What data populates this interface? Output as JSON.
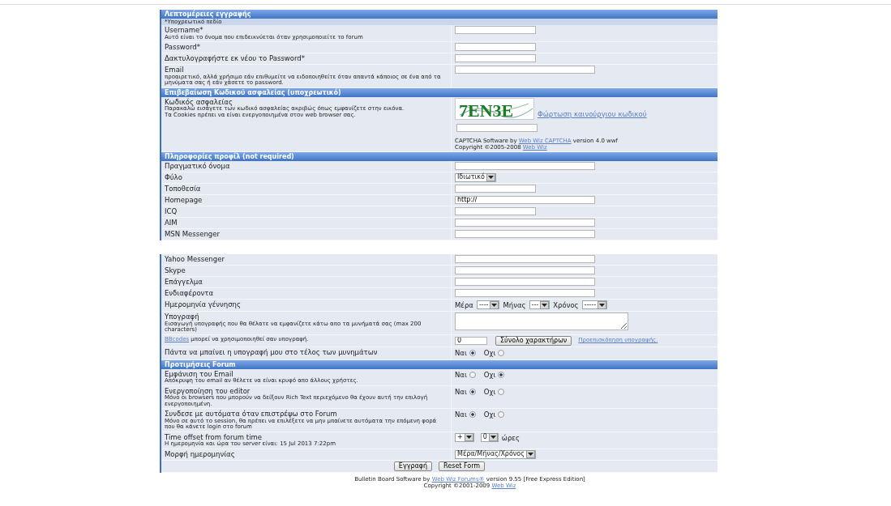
{
  "panels": [
    {
      "rows": [
        {
          "kind": "header",
          "text": "Λεπτομέρειες εγγραφής"
        },
        {
          "kind": "note",
          "text": "*Υποχρεωτικό πεδίο"
        },
        {
          "kind": "short_input",
          "label": "Username*",
          "hint": "Αυτό είναι το όνομα που επιδεικνύεται όταν χρησιμοποιείτε το forum"
        },
        {
          "kind": "short_input",
          "label": "Password*"
        },
        {
          "kind": "short_input",
          "label": "Δακτυλογραφήστε εκ νέου το Password*"
        },
        {
          "kind": "long_input",
          "label": "Email",
          "hint": "προαιρετικό, αλλά χρήσιμο εάν επιθυμείτε να ειδοποιηθείτε όταν απαντά κάποιος σε ένα από τα μηνύματα σας ή εάν χάσετε το password."
        },
        {
          "kind": "header",
          "text": "Επιβεβαίωση Κωδικού ασφαλείας (υποχρεωτικό)"
        },
        {
          "kind": "captcha",
          "label": "Κωδικός ασφαλείας",
          "hint": "Παρακαλώ εισάγετε των κωδικό ασφαλείας ακριβώς όπως εμφανίζετε στην εικόνα.",
          "hint2": "Τα Cookies πρέπει να είναι ενεργοποιημένα στον web browser σας.",
          "image_text": "7EN3E",
          "reload": "Φώρτωση καινούργιου κωδικού",
          "credits": [
            {
              "before": "CAPTCHA Software by ",
              "link": "Web Wiz CAPTCHA",
              "after": " version 4.0 wwf"
            },
            {
              "before": "Copyright ©2005-2008 ",
              "link": "Web Wiz"
            }
          ]
        },
        {
          "kind": "header",
          "text": "Πληροφορίες προφίλ (not required)"
        },
        {
          "kind": "long_input",
          "label": "Πραγματικό όνομα"
        },
        {
          "kind": "select",
          "label": "Φύλο",
          "value": "Ιδιωτικό"
        },
        {
          "kind": "short_input",
          "label": "Τοποθεσία"
        },
        {
          "kind": "long_input",
          "label": "Homepage",
          "value": "http://"
        },
        {
          "kind": "short_input",
          "label": "ICQ"
        },
        {
          "kind": "long_input",
          "label": "AIM"
        },
        {
          "kind": "long_input",
          "label": "MSN Messenger"
        }
      ]
    },
    {
      "rows": [
        {
          "kind": "long_input",
          "label": "Yahoo Messenger"
        },
        {
          "kind": "long_input",
          "label": "Skype"
        },
        {
          "kind": "long_input",
          "label": "Επάγγελμα"
        },
        {
          "kind": "long_input",
          "label": "Ενδιαφέροντα"
        },
        {
          "kind": "date",
          "label": "Ημερομηνία γέννησης",
          "parts": [
            {
              "label": "Μέρα",
              "value": "----"
            },
            {
              "label": "Μήνας",
              "value": "---"
            },
            {
              "label": "Χρόνος",
              "value": "-----"
            }
          ]
        },
        {
          "kind": "textarea",
          "label": "Υπογραφή",
          "hint": "Εισαγωγή υπογραφής που θα θέλατε να εμφανίζετε κάτω απο τα μυνήματά σας (max 200 characters)"
        },
        {
          "kind": "counter",
          "text": {
            "link": "BBcodes",
            "after": " μπορεί να χρησιμοποιηθεί σαν υπογραφή."
          },
          "value": "0",
          "button": "Σύνολο χαρακτήρων",
          "link": "Προεπισκόπηση υπογραφής."
        },
        {
          "kind": "radio",
          "label": "Πάντα να μπαίνει η υπογραφή μου στο τέλος των μυνημάτων",
          "options": [
            {
              "label": "Ναι",
              "selected": true
            },
            {
              "label": "Οχι",
              "selected": false
            }
          ]
        },
        {
          "kind": "header",
          "text": "Προτιμήσεις Forum"
        },
        {
          "kind": "radio",
          "label": "Εμφάνιση του Email",
          "hint": "Απόκρυψη του email αν θέλετε να είναι κρυφό απο άλλους χρήστες.",
          "options": [
            {
              "label": "Ναι",
              "selected": false
            },
            {
              "label": "Οχι",
              "selected": true
            }
          ]
        },
        {
          "kind": "radio",
          "label": "Ενεργοποίηση του editor",
          "hint": "Μόνο οι browsers που μπορούν να δείξουν Rich Text περιεχόμενο θα έχουν αυτή την επιλογή ενεργοποιημένη.",
          "options": [
            {
              "label": "Ναι",
              "selected": true
            },
            {
              "label": "Οχι",
              "selected": false
            }
          ]
        },
        {
          "kind": "radio",
          "label": "Συνδεσε με αυτόματα όταν επιστρέψω στο Forum",
          "hint": "Μόνο σε αυτό το session, θα πρέπει να επιλέξετε να μην μπαίνετε αυτόματα την επόμενη φορά που θα κάνετε login στο forum",
          "options": [
            {
              "label": "Ναι",
              "selected": true
            },
            {
              "label": "Οχι",
              "selected": false
            }
          ]
        },
        {
          "kind": "offset",
          "label": "Time offset from forum time",
          "hint": "Η ημερομηνία και ώρα του server είναι: 15 Jul 2013 7:22pm",
          "sign": "+",
          "hours": "0",
          "unit": "ώρες"
        },
        {
          "kind": "select",
          "label": "Μορφή ημερομηνίας",
          "value": "Μέρα/Μήνας/Χρόνος"
        },
        {
          "kind": "buttons",
          "buttons": [
            "Εγγραφή",
            "Reset Form"
          ]
        }
      ]
    }
  ],
  "footer": [
    {
      "before": "Bulletin Board Software by ",
      "link": "Web Wiz Forums®",
      "after": " version 9.55 [Free Express Edition]"
    },
    {
      "before": "Copyright ©2001-2009 ",
      "link": "Web Wiz"
    }
  ]
}
